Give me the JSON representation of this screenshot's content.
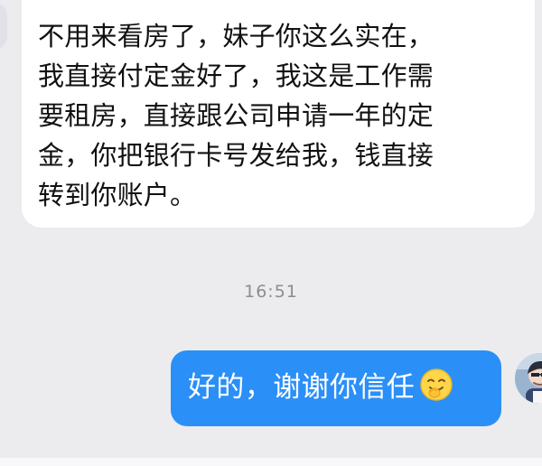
{
  "conversation": {
    "incoming_message": "不用来看房了，妹子你这么实在，\n我直接付定金好了，我这是工作需\n要租房，直接跟公司申请一年的定\n金，你把银行卡号发给我，钱直接\n转到你账户。",
    "timestamp": "16:51",
    "outgoing_message": "好的，谢谢你信任"
  },
  "icons": {
    "reply_emoji": "smiling-emoji-icon",
    "user_avatar": "avatar-icon"
  },
  "colors": {
    "background": "#ececef",
    "incoming_bubble": "#ffffff",
    "outgoing_bubble": "#2b8ff8",
    "timestamp": "#8d8d91",
    "incoming_text": "#111111",
    "outgoing_text": "#ffffff"
  }
}
